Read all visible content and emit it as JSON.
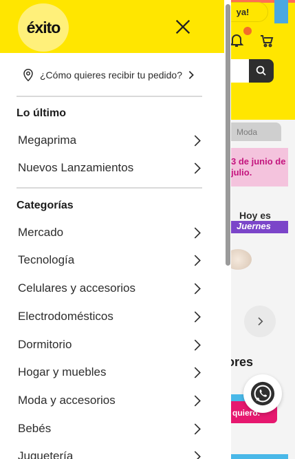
{
  "drawer": {
    "logo_text": "éxito",
    "delivery_label": "¿Cómo quieres recibir tu pedido?",
    "sections": [
      {
        "title": "Lo último",
        "items": [
          "Megaprima",
          "Nuevos Lanzamientos"
        ]
      },
      {
        "title": "Categorías",
        "items": [
          "Mercado",
          "Tecnología",
          "Celulares y accesorios",
          "Electrodomésticos",
          "Dormitorio",
          "Hogar y muebles",
          "Moda y accesorios",
          "Bebés",
          "Juguetería"
        ]
      }
    ]
  },
  "background": {
    "pill_text": "ya!",
    "tab_text": "Moda",
    "banner_text": "3 de junio de julio.",
    "promo_top": "Hoy es",
    "promo_bottom": "Juernes",
    "heading_fragment": "ores",
    "ad_text": "quiero."
  },
  "colors": {
    "brand_yellow": "#ffe600",
    "text_dark": "#2d2d2d",
    "divider": "#d9d9d9"
  },
  "icons": {
    "close": "close-icon",
    "location": "location-pin-icon",
    "chevron": "chevron-right-icon",
    "whatsapp": "whatsapp-icon",
    "bell": "bell-icon",
    "cart": "cart-icon",
    "search": "search-icon"
  }
}
